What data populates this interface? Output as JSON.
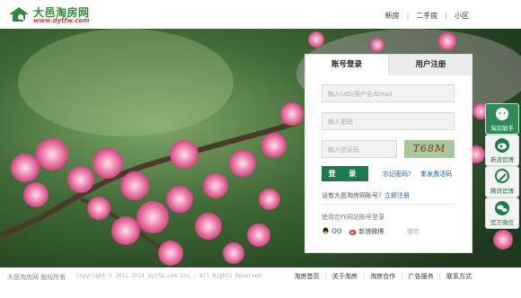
{
  "header": {
    "logo_title": "大邑淘房网",
    "logo_url": "www.dytfw.com",
    "nav": [
      "新房",
      "二手房",
      "小区"
    ]
  },
  "login": {
    "tab_account": "账号登录",
    "tab_register": "用户注册",
    "uid_placeholder": "输入UID/用户名/Email",
    "password_placeholder": "输入密码",
    "captcha_placeholder": "输入验证码",
    "captcha_text": "T68M",
    "login_label": "登 录",
    "forgot": "忘记密码?",
    "resend": "重发激活码",
    "no_account": "没有大邑淘房网账号？",
    "register_now": "立即注册",
    "partner_login": "使用合作网站账号登录",
    "qq": "QQ",
    "sina": "新浪微博",
    "wechat": "微信"
  },
  "sidebar": {
    "items": [
      {
        "label": "淘房助手"
      },
      {
        "label": "新浪官博"
      },
      {
        "label": "腾讯官博"
      },
      {
        "label": "官方微信"
      }
    ]
  },
  "footer": {
    "brand": "大邑淘房网 版权所有",
    "copyright": "Copyright © 2011-2014 Dytfw.com Inc , All Rights Reserved",
    "links": [
      "淘房首页",
      "关于淘房",
      "淘房合作",
      "广告服务",
      "联系方式"
    ]
  },
  "colors": {
    "accent": "#1c7a4c",
    "link": "#2060a0"
  }
}
